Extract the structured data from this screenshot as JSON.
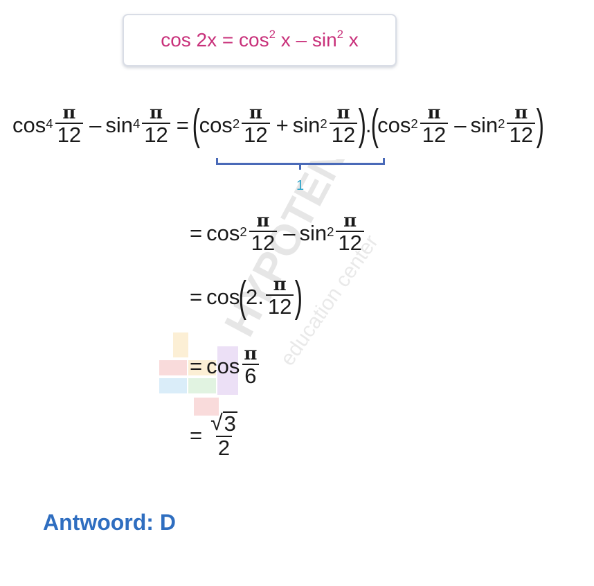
{
  "identity": {
    "lhs": "cos 2x = cos",
    "exp1": "2",
    "mid": " x – sin",
    "exp2": "2",
    "end": " x"
  },
  "line1": {
    "cos": "cos",
    "sin": "sin",
    "pow4": "4",
    "pow2": "2",
    "pi": "π",
    "den": "12",
    "minus": "–",
    "plus": "+",
    "eq": "=",
    "dot": "."
  },
  "brace_label": "1",
  "line2": {
    "eq": "=",
    "cos": "cos",
    "sin": "sin",
    "pow2": "2",
    "pi": "π",
    "den": "12",
    "minus": "–"
  },
  "line3": {
    "eq": "=",
    "cos": "cos",
    "two": "2",
    "dot": ".",
    "pi": "π",
    "den": "12"
  },
  "line4": {
    "eq": "=",
    "cos": "cos",
    "pi": "π",
    "den": "6"
  },
  "line5": {
    "eq": "=",
    "sqrt_arg": "3",
    "den": "2"
  },
  "watermark": {
    "brand": "HYPOTENUSE",
    "sub": "education center"
  },
  "answer": "Antwoord: D",
  "colors": {
    "identity": "#c8307a",
    "brace": "#4a6ab8",
    "brace_label": "#2aa3c9",
    "answer": "#2f6ec0"
  }
}
